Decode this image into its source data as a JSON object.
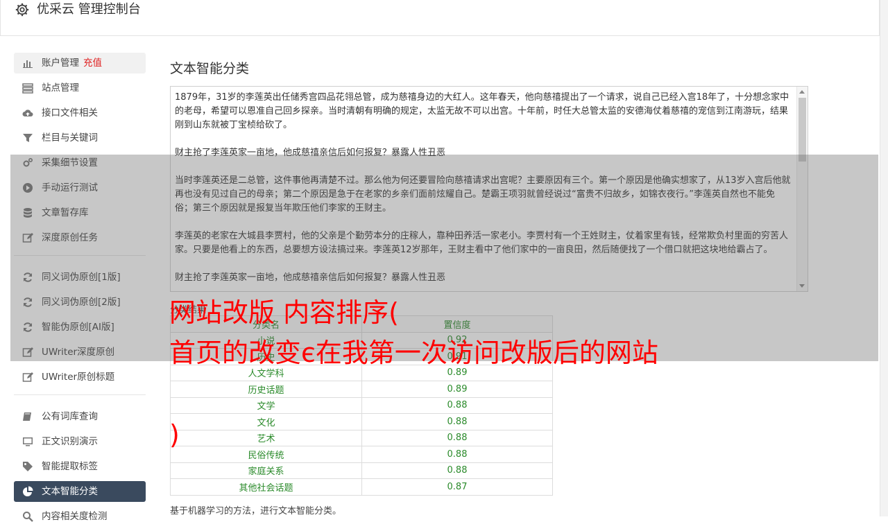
{
  "header": {
    "title": "优采云 管理控制台",
    "icon": "gear-icon"
  },
  "sidebar": {
    "group1": [
      {
        "label": "账户管理",
        "badge": "充值",
        "icon": "bar-chart-icon"
      },
      {
        "label": "站点管理",
        "icon": "server-icon"
      },
      {
        "label": "接口文件相关",
        "icon": "cloud-upload-icon"
      },
      {
        "label": "栏目与关键词",
        "icon": "filter-icon"
      },
      {
        "label": "采集细节设置",
        "icon": "gears-icon"
      },
      {
        "label": "手动运行测试",
        "icon": "play-circle-icon"
      },
      {
        "label": "文章暂存库",
        "icon": "database-icon"
      },
      {
        "label": "深度原创任务",
        "icon": "edit-icon"
      }
    ],
    "group2": [
      {
        "label": "同义词伪原创[1版]",
        "icon": "refresh-icon"
      },
      {
        "label": "同义词伪原创[2版]",
        "icon": "refresh-icon"
      },
      {
        "label": "智能伪原创[AI版]",
        "icon": "refresh-icon"
      },
      {
        "label": "UWriter深度原创",
        "icon": "edit-icon"
      },
      {
        "label": "UWriter原创标题",
        "icon": "edit-icon"
      }
    ],
    "group3": [
      {
        "label": "公有词库查询",
        "icon": "book-icon"
      },
      {
        "label": "正文识别演示",
        "icon": "monitor-icon"
      },
      {
        "label": "智能提取标签",
        "icon": "tag-icon"
      },
      {
        "label": "文本智能分类",
        "icon": "pie-chart-icon"
      },
      {
        "label": "内容相关度检测",
        "icon": "search-icon"
      }
    ]
  },
  "main": {
    "title": "文本智能分类",
    "text_paragraphs": [
      "1879年，31岁的李莲英出任储秀宫四品花翎总管，成为慈禧身边的大红人。这年春天，他向慈禧提出了一个请求，说自己已经入宫18年了，十分想念家中的老母，希望可以恩准自己回乡探亲。当时清朝有明确的规定，太监无故不可以出宫。十年前，时任大总管太监的安德海仗着慈禧的宠信到江南游玩，结果刚到山东就被丁宝桢给砍了。",
      "财主抢了李莲英家一亩地，他成慈禧亲信后如何报复？暴露人性丑恶",
      "当时李莲英还是二总管，这件事他再清楚不过。那么他为何还要冒险向慈禧请求出宫呢？主要原因有三个。第一个原因是他确实想家了，从13岁入宫后他就再也没有见过自己的母亲；第二个原因是急于在老家的乡亲们面前炫耀自己。楚霸王项羽就曾经说过“富贵不归故乡，如锦衣夜行。”李莲英自然也不能免俗；第三个原因就是报复当年欺压他们李家的王财主。",
      "李莲英的老家在大城县李贾村，他的父亲是个勤劳本分的庄稼人，靠种田养活一家老小。李贾村有一个王姓财主，仗着家里有钱，经常欺负村里面的穷苦人家。只要是他看上的东西，总要想方设法搞过来。李莲英12岁那年，王财主看中了他们家中的一亩良田，然后随便找了一个借口就把这块地给霸占了。",
      "财主抢了李莲英家一亩地，他成慈禧亲信后如何报复？暴露人性丑恶"
    ],
    "result_label": "分类结果",
    "table": {
      "headers": [
        "分类名",
        "置信度"
      ],
      "rows": [
        [
          "小说",
          "0.92"
        ],
        [
          "历史",
          "0.91"
        ],
        [
          "人文学科",
          "0.89"
        ],
        [
          "历史话题",
          "0.89"
        ],
        [
          "文学",
          "0.88"
        ],
        [
          "文化",
          "0.88"
        ],
        [
          "艺术",
          "0.88"
        ],
        [
          "民俗传统",
          "0.88"
        ],
        [
          "家庭关系",
          "0.88"
        ],
        [
          "其他社会话题",
          "0.87"
        ]
      ]
    },
    "footnote": "基于机器学习的方法，进行文本智能分类。"
  },
  "overlay": {
    "line1": "网站改版 内容排序(",
    "line2": "首页的改变є在我第一次访问改版后的网站",
    "line3": ")",
    "color": "#ff0000"
  }
}
